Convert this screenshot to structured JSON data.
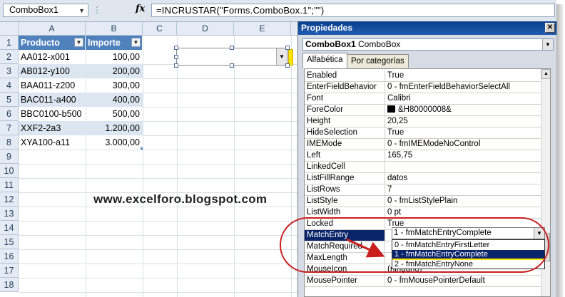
{
  "formula_bar": {
    "name_box": "ComboBox1",
    "fx_symbol": "fx",
    "formula": "=INCRUSTAR(\"Forms.ComboBox.1\";\"\")"
  },
  "sheet": {
    "columns": [
      "A",
      "B",
      "C",
      "D",
      "E"
    ],
    "rows": [
      "1",
      "2",
      "3",
      "4",
      "5",
      "6",
      "7",
      "8",
      "9",
      "10",
      "11",
      "12",
      "13",
      "14",
      "15",
      "16",
      "17",
      "18"
    ],
    "table_headers": [
      "Producto",
      "Importe"
    ],
    "table_rows": [
      [
        "AA012-x001",
        "100,00"
      ],
      [
        "AB012-y100",
        "200,00"
      ],
      [
        "BAA011-z200",
        "300,00"
      ],
      [
        "BAC011-a400",
        "400,00"
      ],
      [
        "BBC0100-b500",
        "500,00"
      ],
      [
        "XXF2-2a3",
        "1.200,00"
      ],
      [
        "XYA100-a11",
        "3.000,00"
      ]
    ],
    "watermark": "www.excelforo.blogspot.com"
  },
  "properties": {
    "title": "Propiedades",
    "object_name": "ComboBox1",
    "object_type": "ComboBox",
    "tabs": [
      "Alfabética",
      "Por categorías"
    ],
    "rows": [
      {
        "name": "Enabled",
        "value": "True"
      },
      {
        "name": "EnterFieldBehavior",
        "value": "0 - fmEnterFieldBehaviorSelectAll"
      },
      {
        "name": "Font",
        "value": "Calibri"
      },
      {
        "name": "ForeColor",
        "value": "&H80000008&"
      },
      {
        "name": "Height",
        "value": "20,25"
      },
      {
        "name": "HideSelection",
        "value": "True"
      },
      {
        "name": "IMEMode",
        "value": "0 - fmIMEModeNoControl"
      },
      {
        "name": "Left",
        "value": "165,75"
      },
      {
        "name": "LinkedCell",
        "value": ""
      },
      {
        "name": "ListFillRange",
        "value": "datos"
      },
      {
        "name": "ListRows",
        "value": "7"
      },
      {
        "name": "ListStyle",
        "value": "0 - fmListStylePlain"
      },
      {
        "name": "ListWidth",
        "value": "0 pt"
      },
      {
        "name": "Locked",
        "value": "True"
      },
      {
        "name": "MatchEntry",
        "value": "1 - fmMatchEntryComplete"
      },
      {
        "name": "MatchRequired",
        "value": ""
      },
      {
        "name": "MaxLength",
        "value": ""
      },
      {
        "name": "MouseIcon",
        "value": "(ninguno)"
      },
      {
        "name": "MousePointer",
        "value": "0 - fmMousePointerDefault"
      }
    ],
    "match_entry_options": [
      "0 - fmMatchEntryFirstLetter",
      "1 - fmMatchEntryComplete",
      "2 - fmMatchEntryNone"
    ],
    "selected_option_index": 1
  },
  "colors": {
    "table_header": "#4f81bd",
    "table_band": "#dce6f1",
    "selection": "#0a246a",
    "highlight_circle": "#c81e1e",
    "arrow": "#c81e1e",
    "yellow": "#ffe600"
  }
}
